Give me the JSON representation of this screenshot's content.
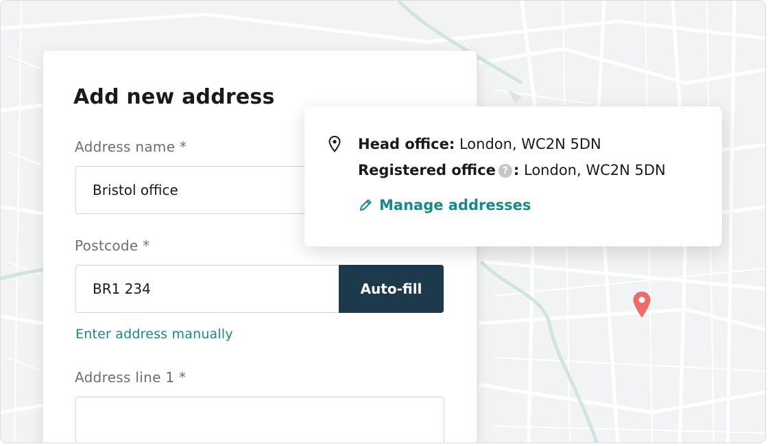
{
  "form": {
    "title": "Add new address",
    "address_name_label": "Address name *",
    "address_name_value": "Bristol office",
    "postcode_label": "Postcode *",
    "postcode_value": "BR1 234",
    "autofill_label": "Auto-fill",
    "manual_link": "Enter address manually",
    "address_line1_label": "Address line 1 *",
    "address_line1_value": ""
  },
  "popover": {
    "head_office_label": "Head office:",
    "head_office_value": "London, WC2N 5DN",
    "registered_office_label": "Registered office",
    "help_glyph": "?",
    "registered_office_sep": ":",
    "registered_office_value": "London, WC2N 5DN",
    "manage_link": "Manage addresses"
  },
  "icons": {
    "location": "map-pin-outline-icon",
    "edit": "pencil-icon",
    "help": "question-circle-icon",
    "marker": "map-marker-icon"
  },
  "colors": {
    "primary_dark": "#1d3a4c",
    "link_teal": "#148a8a",
    "marker": "#ee6b66",
    "map_background": "#f2f3f4",
    "map_water": "#cfe6e0"
  }
}
